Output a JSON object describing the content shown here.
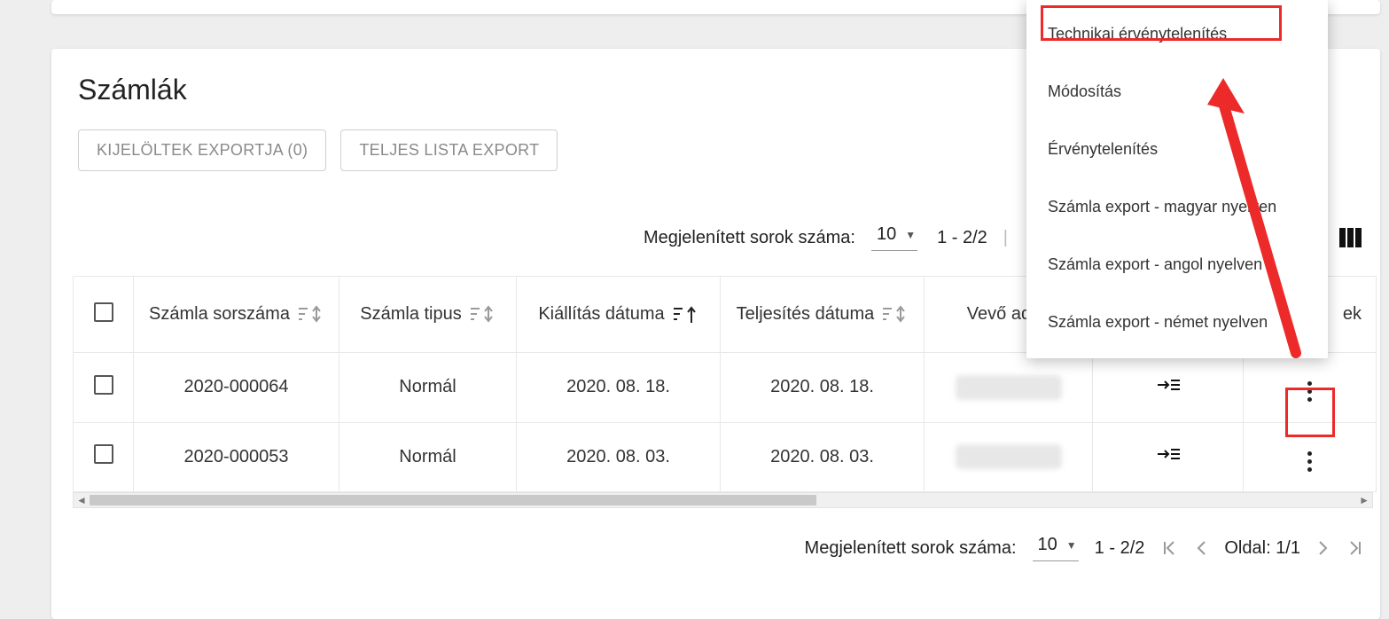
{
  "header": {
    "title": "Számlák"
  },
  "toolbar": {
    "export_selected_label": "KIJELÖLTEK EXPORTJA (0)",
    "export_all_label": "TELJES LISTA EXPORT"
  },
  "pagination": {
    "rows_label": "Megjelenített sorok száma:",
    "page_size": "10",
    "range": "1 - 2/2",
    "page_label_prefix": "Oldal:",
    "page_value": "1/1"
  },
  "columns": {
    "col1": "Számla sorszáma",
    "col2": "Számla tipus",
    "col3": "Kiállítás dátuma",
    "col4": "Teljesítés dátuma",
    "col5": "Vevő adós",
    "col7_suffix": "ek"
  },
  "rows": [
    {
      "id": "2020-000064",
      "type": "Normál",
      "issue": "2020. 08. 18.",
      "fulfil": "2020. 08. 18."
    },
    {
      "id": "2020-000053",
      "type": "Normál",
      "issue": "2020. 08. 03.",
      "fulfil": "2020. 08. 03."
    }
  ],
  "menu": {
    "items": [
      "Technikai érvénytelenítés",
      "Módosítás",
      "Érvénytelenítés",
      "Számla export - magyar nyelven",
      "Számla export - angol nyelven",
      "Számla export - német nyelven"
    ]
  }
}
